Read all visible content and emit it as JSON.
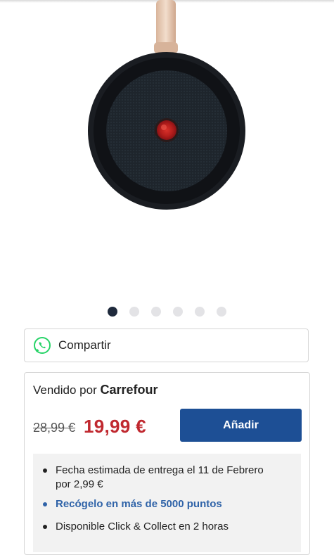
{
  "carousel": {
    "image_icon": "frying-pan-image",
    "total_slides": 6,
    "active_index": 0
  },
  "share": {
    "icon": "whatsapp-icon",
    "label": "Compartir"
  },
  "seller": {
    "prefix": "Vendido por",
    "name": "Carrefour"
  },
  "price": {
    "old": "28,99 €",
    "current": "19,99 €",
    "current_color": "#c0282f"
  },
  "actions": {
    "add_label": "Añadir",
    "add_color": "#1d4f95"
  },
  "delivery_info": [
    {
      "text": "Fecha estimada de entrega el 11 de Febrero por 2,99 €",
      "link": false
    },
    {
      "text": "Recógelo en más de 5000 puntos",
      "link": true
    },
    {
      "text": "Disponible Click & Collect en 2 horas",
      "link": false
    }
  ]
}
